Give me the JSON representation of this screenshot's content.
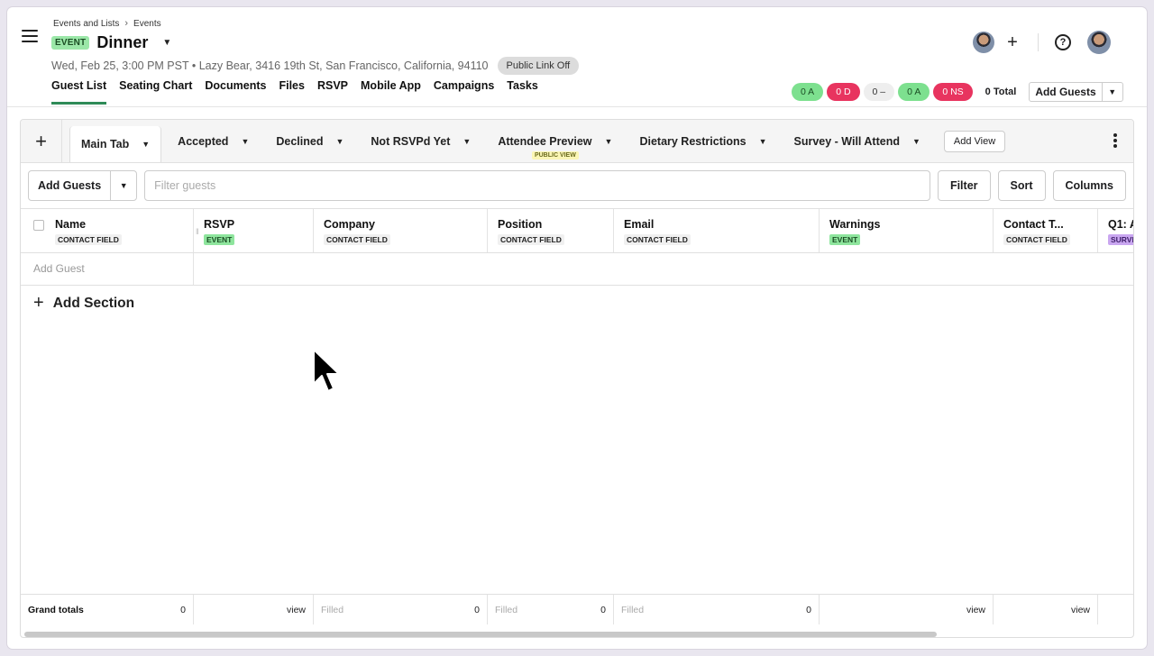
{
  "breadcrumb": {
    "item1": "Events and Lists",
    "sep": "›",
    "item2": "Events"
  },
  "event": {
    "badge": "EVENT",
    "title": "Dinner",
    "details": "Wed, Feb 25, 3:00 PM PST • Lazy Bear, 3416 19th St, San Francisco, California, 94110",
    "public_link": "Public Link Off"
  },
  "nav": {
    "tabs": [
      "Guest List",
      "Seating Chart",
      "Documents",
      "Files",
      "RSVP",
      "Mobile App",
      "Campaigns",
      "Tasks"
    ],
    "active": "Guest List"
  },
  "stats": {
    "accepted1": "0 A",
    "declined": "0 D",
    "pending": "0 –",
    "accepted2": "0 A",
    "not_sent": "0 NS",
    "total": "0 Total",
    "add_guests": "Add Guests",
    "colors": {
      "green": "#7de08f",
      "red": "#e8345f"
    }
  },
  "views": {
    "tabs": [
      "Main Tab",
      "Accepted",
      "Declined",
      "Not RSVPd Yet",
      "Attendee Preview",
      "Dietary Restrictions",
      "Survey - Will Attend"
    ],
    "public_badge": "PUBLIC VIEW",
    "add_view": "Add View"
  },
  "toolbar": {
    "add_guests": "Add Guests",
    "filter_placeholder": "Filter guests",
    "filter": "Filter",
    "sort": "Sort",
    "columns": "Columns"
  },
  "columns": [
    {
      "name": "Name",
      "tag": "CONTACT FIELD"
    },
    {
      "name": "RSVP",
      "tag": "EVENT"
    },
    {
      "name": "Company",
      "tag": "CONTACT FIELD"
    },
    {
      "name": "Position",
      "tag": "CONTACT FIELD"
    },
    {
      "name": "Email",
      "tag": "CONTACT FIELD"
    },
    {
      "name": "Warnings",
      "tag": "EVENT"
    },
    {
      "name": "Contact T...",
      "tag": "CONTACT FIELD"
    },
    {
      "name": "Q1: A",
      "tag": "SURVE"
    }
  ],
  "rows": {
    "add_guest": "Add Guest",
    "add_section": "Add Section"
  },
  "totals": {
    "label": "Grand totals",
    "name_count": "0",
    "rsvp": "view",
    "company_label": "Filled",
    "company_count": "0",
    "position_label": "Filled",
    "position_count": "0",
    "email_label": "Filled",
    "email_count": "0",
    "warnings": "view",
    "contact_type": "view"
  }
}
